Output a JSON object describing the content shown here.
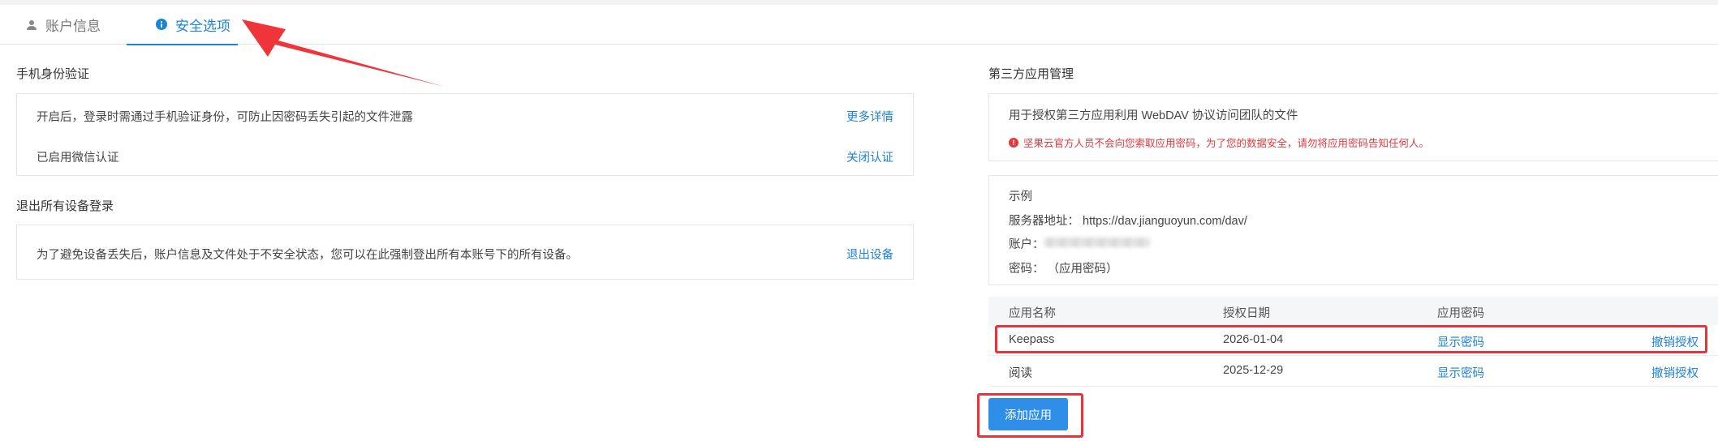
{
  "tabs": {
    "account_label": "账户信息",
    "security_label": "安全选项"
  },
  "phone_auth": {
    "title": "手机身份验证",
    "description": "开启后，登录时需通过手机验证身份，可防止因密码丢失引起的文件泄露",
    "more_link": "更多详情",
    "status": "已启用微信认证",
    "close_link": "关闭认证"
  },
  "logout_devices": {
    "title": "退出所有设备登录",
    "description": "为了避免设备丢失后，账户信息及文件处于不安全状态，您可以在此强制登出所有本账号下的所有设备。",
    "logout_link": "退出设备"
  },
  "third_party": {
    "title": "第三方应用管理",
    "description": "用于授权第三方应用利用 WebDAV 协议访问团队的文件",
    "warning": "坚果云官方人员不会向您索取应用密码，为了您的数据安全，请勿将应用密码告知任何人。",
    "example": {
      "heading": "示例",
      "server_label": "服务器地址：",
      "server_value": "https://dav.jianguoyun.com/dav/",
      "account_label": "账户：",
      "password_label": "密码：",
      "password_value": "（应用密码）"
    },
    "table": {
      "headers": [
        "应用名称",
        "授权日期",
        "应用密码"
      ],
      "rows": [
        {
          "name": "Keepass",
          "date": "2026-01-04",
          "show": "显示密码",
          "revoke": "撤销授权"
        },
        {
          "name": "阅读",
          "date": "2025-12-29",
          "show": "显示密码",
          "revoke": "撤销授权"
        }
      ]
    },
    "add_button": "添加应用"
  },
  "colors": {
    "accent": "#1f83d6",
    "button": "#2f8fe8",
    "warning": "#e0393e",
    "annotation": "#e8333a"
  }
}
